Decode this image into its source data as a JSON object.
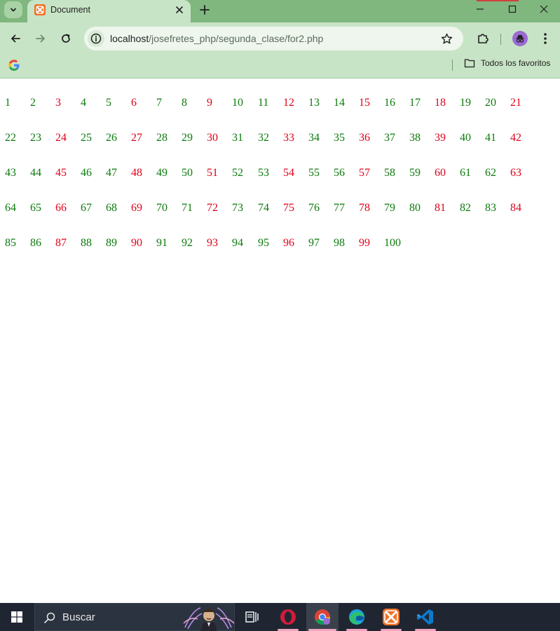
{
  "browser": {
    "tab_title": "Document",
    "url_host": "localhost",
    "url_path": "/josefretes_php/segunda_clase/for2.php",
    "bookmarks_all_label": "Todos los favoritos",
    "colors": {
      "frame": "#7fb77e",
      "toolbar": "#c8e4c6"
    }
  },
  "content": {
    "colors": {
      "even": "#0c7a0c",
      "odd": "#e0001a"
    },
    "numbers": [
      "1",
      "2",
      "3",
      "4",
      "5",
      "6",
      "7",
      "8",
      "9",
      "10",
      "11",
      "12",
      "13",
      "14",
      "15",
      "16",
      "17",
      "18",
      "19",
      "20",
      "21",
      "22",
      "23",
      "24",
      "25",
      "26",
      "27",
      "28",
      "29",
      "30",
      "31",
      "32",
      "33",
      "34",
      "35",
      "36",
      "37",
      "38",
      "39",
      "40",
      "41",
      "42",
      "43",
      "44",
      "45",
      "46",
      "47",
      "48",
      "49",
      "50",
      "51",
      "52",
      "53",
      "54",
      "55",
      "56",
      "57",
      "58",
      "59",
      "60",
      "61",
      "62",
      "63",
      "64",
      "65",
      "66",
      "67",
      "68",
      "69",
      "70",
      "71",
      "72",
      "73",
      "74",
      "75",
      "76",
      "77",
      "78",
      "79",
      "80",
      "81",
      "82",
      "83",
      "84",
      "85",
      "86",
      "87",
      "88",
      "89",
      "90",
      "91",
      "92",
      "93",
      "94",
      "95",
      "96",
      "97",
      "98",
      "99",
      "100"
    ]
  },
  "taskbar": {
    "search_placeholder": "Buscar",
    "apps": [
      "task-view",
      "opera",
      "chrome",
      "edge",
      "xampp",
      "vscode"
    ]
  }
}
